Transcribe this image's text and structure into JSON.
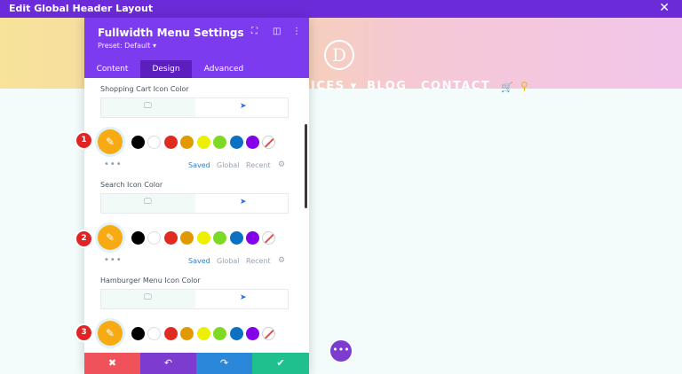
{
  "window": {
    "title": "Edit Global Header Layout",
    "close_glyph": "✕"
  },
  "preview": {
    "logo": "D",
    "nav": [
      {
        "label": "ICES ▾"
      },
      {
        "label": "BLOG"
      },
      {
        "label": "CONTACT"
      }
    ],
    "cart_icon": "🛒",
    "search_icon": "⚲"
  },
  "panel": {
    "title": "Fullwidth Menu Settings",
    "preset": "Preset: Default ▾",
    "head_icons": {
      "focus": "⛶",
      "columns": "◫",
      "more": "⋮"
    },
    "tabs": [
      {
        "label": "Content",
        "active": false
      },
      {
        "label": "Design",
        "active": true
      },
      {
        "label": "Advanced",
        "active": false
      }
    ],
    "sections": [
      {
        "label": "Shopping Cart Icon Color",
        "badge": "1"
      },
      {
        "label": "Search Icon Color",
        "badge": "2"
      },
      {
        "label": "Hamburger Menu Icon Color",
        "badge": "3"
      }
    ],
    "device_icons": {
      "desktop": "🖵",
      "hover": "➤"
    },
    "picker_glyph": "✎",
    "swatch_colors": [
      "#000000",
      "#ffffff",
      "#e02b20",
      "#e09900",
      "#edf000",
      "#7cda24",
      "#0c71c3",
      "#8300e9"
    ],
    "more_dots": "•••",
    "tabs_palette": {
      "saved": "Saved",
      "global": "Global",
      "recent": "Recent"
    },
    "gear_glyph": "⚙"
  },
  "actions": {
    "cancel": "✖",
    "undo": "↶",
    "redo": "↷",
    "save": "✔"
  },
  "fab_glyph": "•••"
}
